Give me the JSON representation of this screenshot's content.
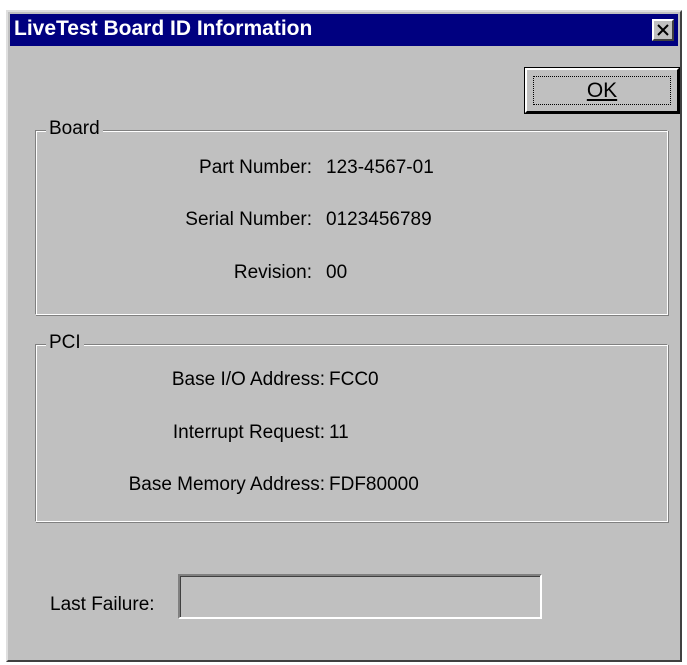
{
  "window": {
    "title": "LiveTest Board ID Information",
    "close_symbol": "×"
  },
  "ok_button": {
    "label": "OK"
  },
  "board_group": {
    "label": "Board",
    "fields": [
      {
        "label": "Part Number:",
        "value": "123-4567-01"
      },
      {
        "label": "Serial Number:",
        "value": "0123456789"
      },
      {
        "label": "Revision:",
        "value": "00"
      }
    ]
  },
  "pci_group": {
    "label": "PCI",
    "fields": [
      {
        "label": "Base I/O Address:",
        "value": "FCC0"
      },
      {
        "label": "Interrupt Request:",
        "value": "11"
      },
      {
        "label": "Base Memory Address:",
        "value": "FDF80000"
      }
    ]
  },
  "last_failure": {
    "label": "Last Failure:",
    "value": ""
  },
  "colors": {
    "titlebar": "#000080",
    "face": "#c0c0c0"
  }
}
